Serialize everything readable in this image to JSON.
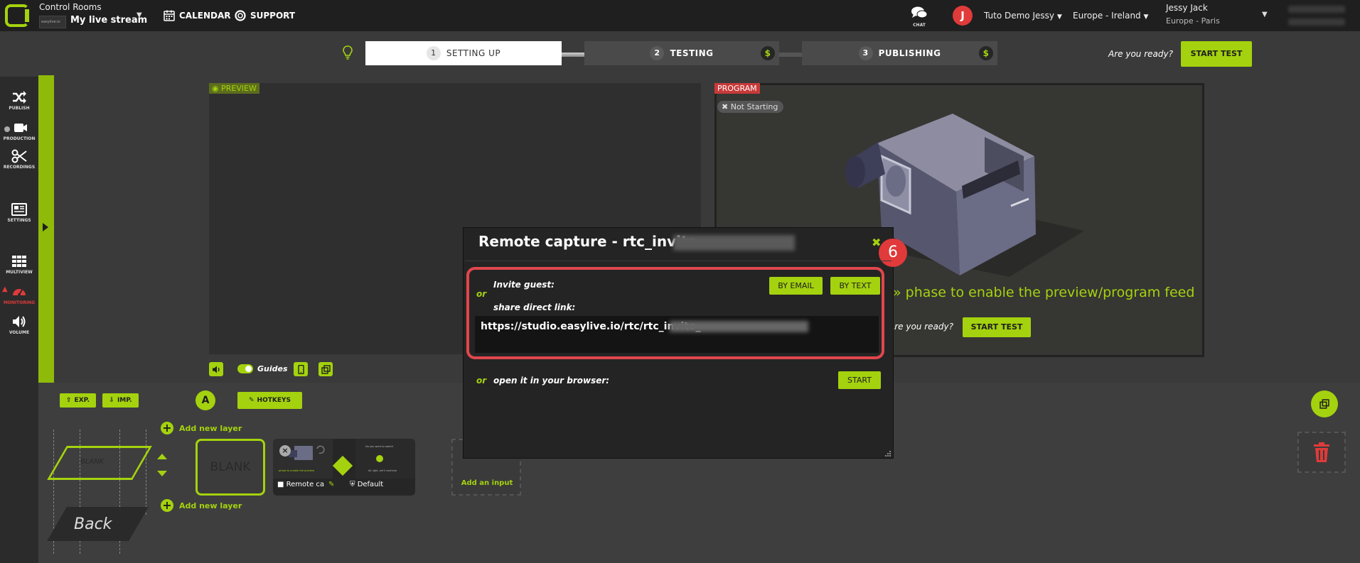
{
  "topbar": {
    "control_rooms": "Control Rooms",
    "stream_name": "My live stream",
    "thumb_text": "easylive.io",
    "calendar": "CALENDAR",
    "support": "SUPPORT",
    "chat": "CHAT",
    "avatar_letter": "J",
    "account": "Tuto Demo Jessy",
    "region": "Europe - Ireland",
    "user_name": "Jessy Jack",
    "user_tz": "Europe - Paris"
  },
  "steps": [
    {
      "num": "1",
      "label": "SETTING UP"
    },
    {
      "num": "2",
      "label": "TESTING"
    },
    {
      "num": "3",
      "label": "PUBLISHING"
    }
  ],
  "header": {
    "ready": "Are you ready?",
    "start_test": "START TEST"
  },
  "sidebar": {
    "items": [
      {
        "label": "PUBLISH",
        "icon": "shuffle-icon"
      },
      {
        "label": "PRODUCTION",
        "icon": "video-camera-icon"
      },
      {
        "label": "RECORDINGS",
        "icon": "scissors-icon"
      },
      {
        "label": "SETTINGS",
        "icon": "newspaper-icon"
      },
      {
        "label": "MULTIVIEW",
        "icon": "grid-icon"
      },
      {
        "label": "MONITORING",
        "icon": "gauge-icon"
      },
      {
        "label": "VOLUME",
        "icon": "speaker-icon"
      }
    ]
  },
  "preview": {
    "tag": "PREVIEW",
    "guides": "Guides"
  },
  "program": {
    "tag": "PROGRAM",
    "status": "Not Starting",
    "message": "» phase to enable the preview/program feed",
    "ready": "Are you ready?",
    "start_test": "START TEST"
  },
  "bottom": {
    "exp": "EXP.",
    "imp": "IMP.",
    "a": "A",
    "hotkeys": "HOTKEYS",
    "add_layer": "Add new layer",
    "blank": "BLANK",
    "back": "Back",
    "blank_card": "BLANK",
    "input_name": "Remote cap",
    "input_profile": "Default",
    "add_input": "Add an input"
  },
  "modal": {
    "title": "Remote capture - rtc_invite",
    "invite_guest": "Invite guest:",
    "by_email": "BY EMAIL",
    "by_text": "BY TEXT",
    "or": "or",
    "share_link": "share direct link:",
    "link": "https://studio.easylive.io/rtc/rtc_invite_",
    "open_browser": "open it in your browser:",
    "start": "START",
    "step_badge": "6"
  },
  "colors": {
    "accent": "#a4d20e",
    "alert": "#e03a3a",
    "highlight": "#e0474c"
  }
}
